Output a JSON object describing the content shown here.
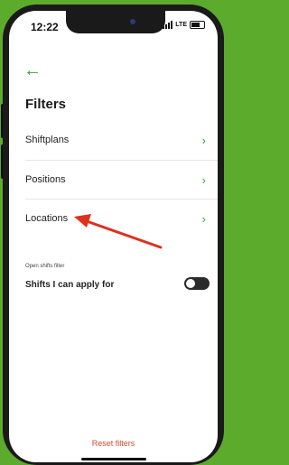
{
  "status_bar": {
    "time": "12:22",
    "network": "LTE"
  },
  "header": {
    "back_icon": "arrow-left-icon",
    "title": "Filters"
  },
  "filters": [
    {
      "label": "Shiftplans",
      "chevron": "chevron-right-icon"
    },
    {
      "label": "Positions",
      "chevron": "chevron-right-icon"
    },
    {
      "label": "Locations",
      "chevron": "chevron-right-icon"
    }
  ],
  "open_shifts": {
    "caption": "Open shifts filter",
    "label": "Shifts I can apply for",
    "toggle_on": false
  },
  "footer": {
    "reset_label": "Reset filters"
  },
  "colors": {
    "accent": "#37a23c",
    "reset": "#d04a2c",
    "background": "#5dab2c",
    "annotation": "#e0301e"
  }
}
